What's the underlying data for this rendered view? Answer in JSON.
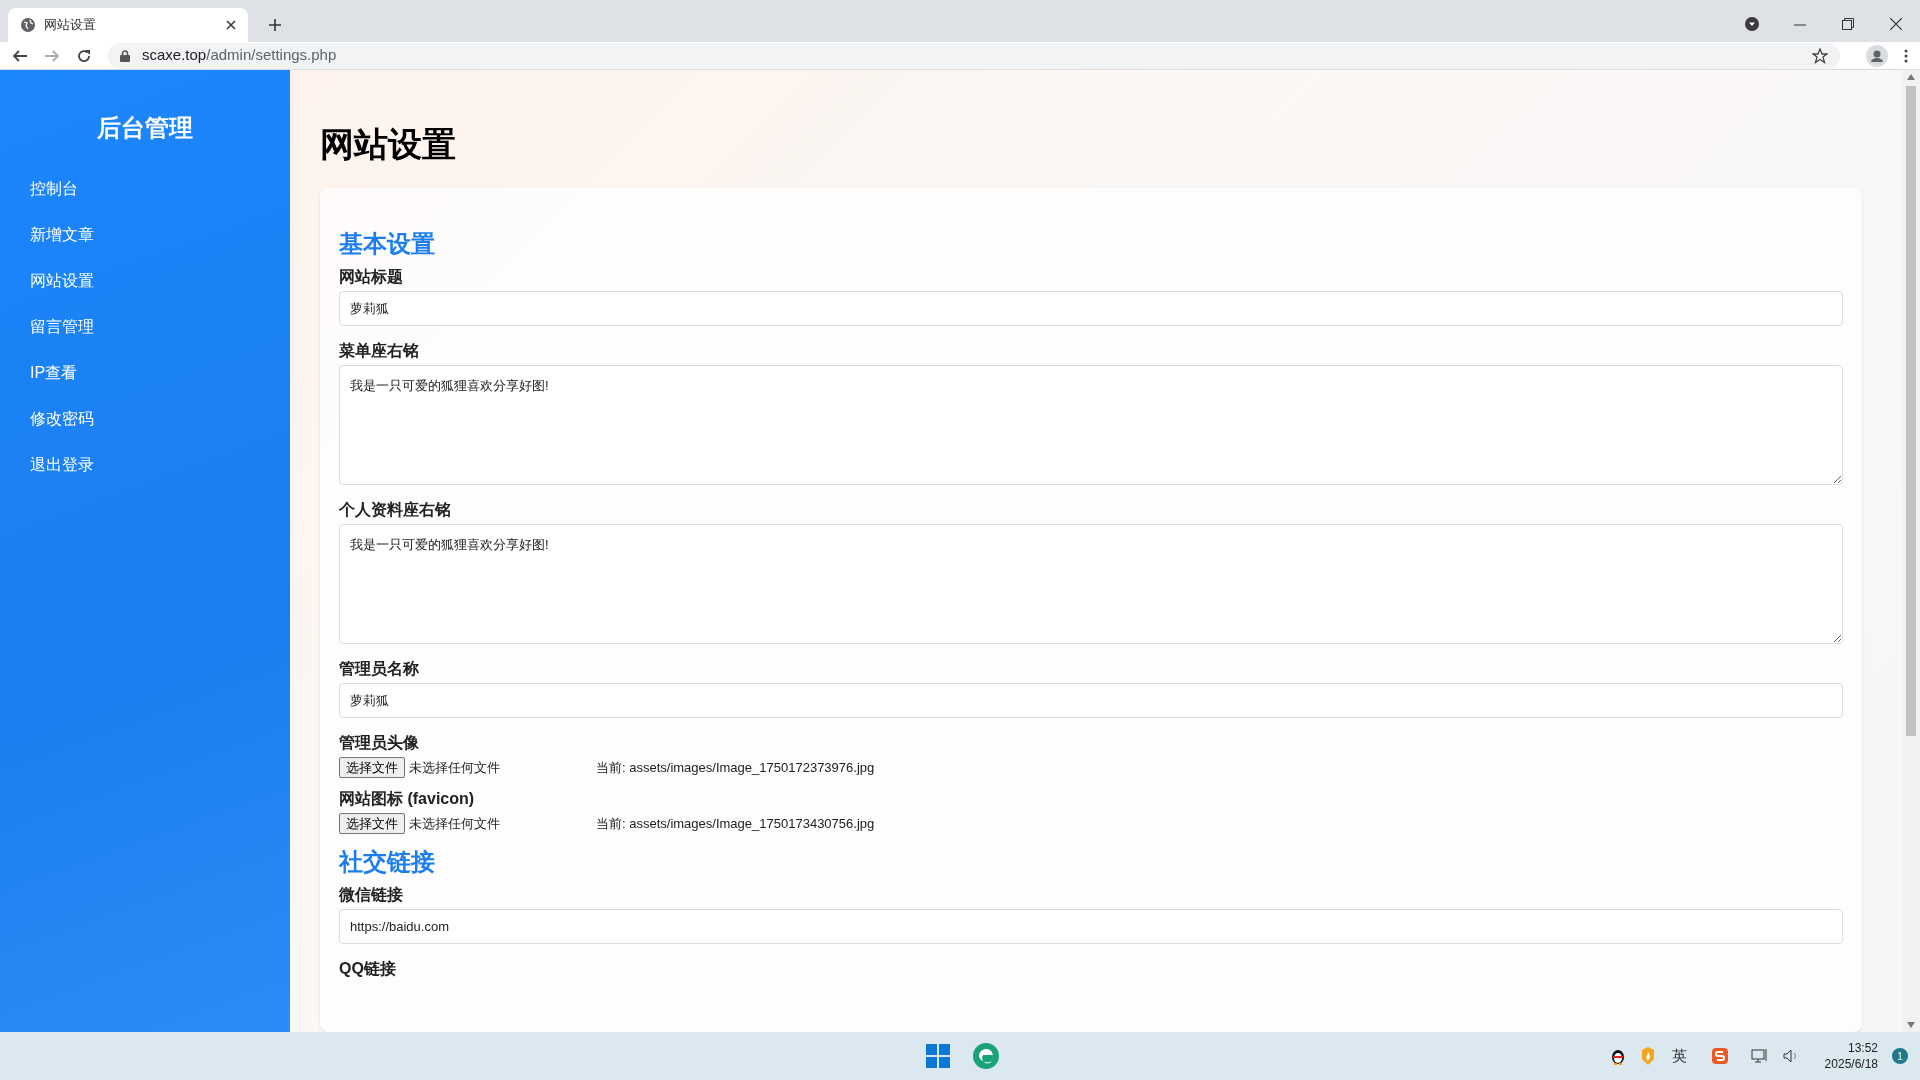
{
  "browser": {
    "tab_title": "网站设置",
    "url_host": "scaxe.top",
    "url_path": "/admin/settings.php"
  },
  "sidebar": {
    "title": "后台管理",
    "items": [
      {
        "label": "控制台"
      },
      {
        "label": "新增文章"
      },
      {
        "label": "网站设置"
      },
      {
        "label": "留言管理"
      },
      {
        "label": "IP查看"
      },
      {
        "label": "修改密码"
      },
      {
        "label": "退出登录"
      }
    ]
  },
  "page_title": "网站设置",
  "sections": [
    {
      "title": "基本设置",
      "fields": [
        {
          "kind": "input",
          "label": "网站标题",
          "value": "萝莉狐"
        },
        {
          "kind": "textarea",
          "label": "菜单座右铭",
          "value": "我是一只可爱的狐狸喜欢分享好图!"
        },
        {
          "kind": "textarea",
          "label": "个人资料座右铭",
          "value": "我是一只可爱的狐狸喜欢分享好图!"
        },
        {
          "kind": "input",
          "label": "管理员名称",
          "value": "萝莉狐"
        },
        {
          "kind": "file",
          "label": "管理员头像",
          "button": "选择文件",
          "status": "未选择任何文件",
          "current": "当前: assets/images/Image_1750172373976.jpg"
        },
        {
          "kind": "file",
          "label": "网站图标 (favicon)",
          "button": "选择文件",
          "status": "未选择任何文件",
          "current": "当前: assets/images/Image_1750173430756.jpg"
        }
      ]
    },
    {
      "title": "社交链接",
      "fields": [
        {
          "kind": "input",
          "label": "微信链接",
          "value": "https://baidu.com"
        },
        {
          "kind": "label_only",
          "label": "QQ链接"
        }
      ]
    }
  ],
  "taskbar": {
    "ime": "英",
    "time": "13:52",
    "date": "2025/6/18",
    "notifications": "1"
  }
}
